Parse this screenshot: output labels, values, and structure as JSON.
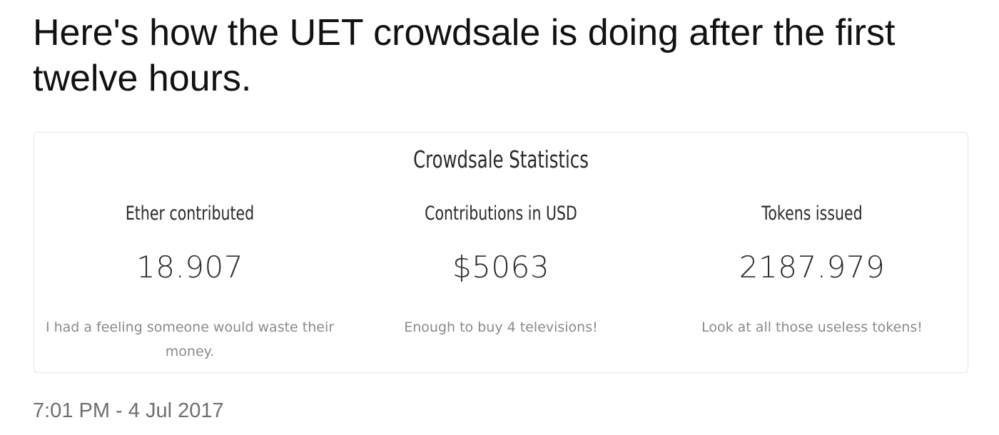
{
  "tweet": {
    "text": "Here's how the UET crowdsale is doing after the first twelve hours.",
    "timestamp": "7:01 PM - 4 Jul 2017"
  },
  "card": {
    "title": "Crowdsale Statistics",
    "stats": [
      {
        "label": "Ether contributed",
        "value": "18.907",
        "caption": "I had a feeling someone would waste their money."
      },
      {
        "label": "Contributions in USD",
        "value": "$5063",
        "caption": "Enough to buy 4 televisions!"
      },
      {
        "label": "Tokens issued",
        "value": "2187.979",
        "caption": "Look at all those useless tokens!"
      }
    ]
  }
}
